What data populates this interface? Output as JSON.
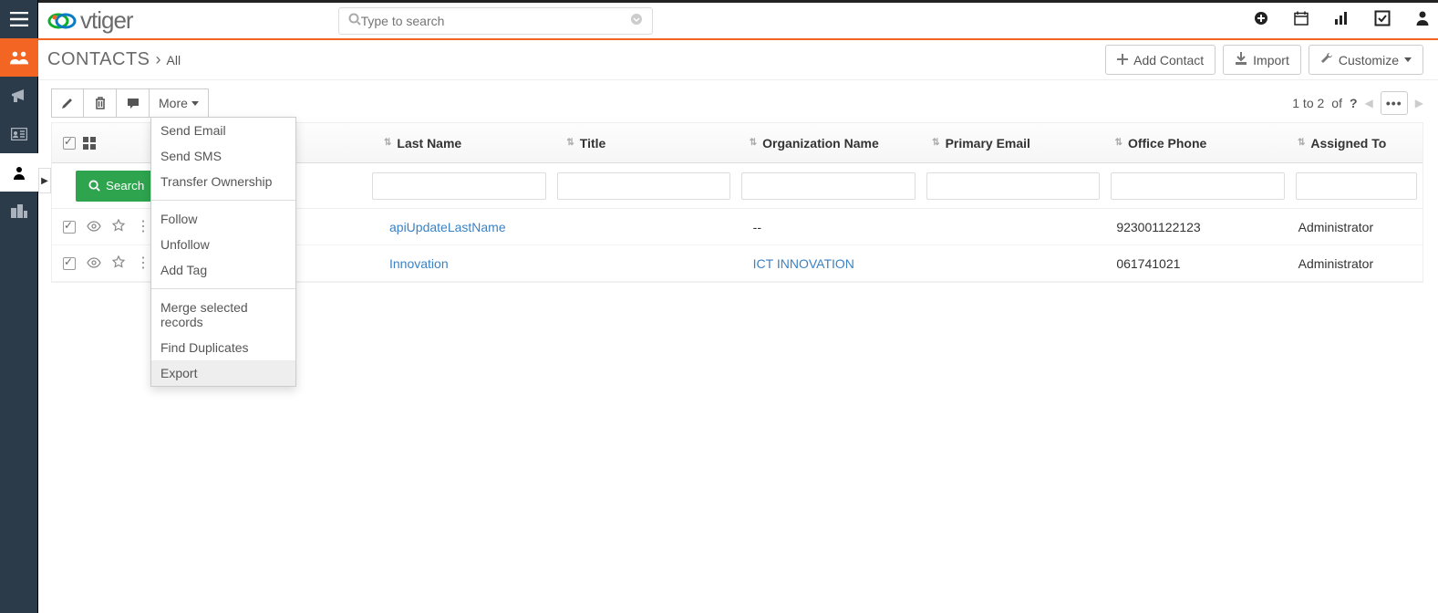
{
  "app": {
    "name": "vtiger"
  },
  "search": {
    "placeholder": "Type to search"
  },
  "breadcrumb": {
    "module": "CONTACTS",
    "filter": "All"
  },
  "header_buttons": {
    "add": "Add Contact",
    "import": "Import",
    "customize": "Customize"
  },
  "toolbar": {
    "more": "More"
  },
  "paging": {
    "range": "1 to 2",
    "of": "of",
    "total": "?"
  },
  "more_menu": {
    "send_email": "Send Email",
    "send_sms": "Send SMS",
    "transfer": "Transfer Ownership",
    "follow": "Follow",
    "unfollow": "Unfollow",
    "add_tag": "Add Tag",
    "merge": "Merge selected records",
    "find_dupes": "Find Duplicates",
    "export": "Export"
  },
  "columns": {
    "last_name": "Last Name",
    "title": "Title",
    "org": "Organization Name",
    "email": "Primary Email",
    "phone": "Office Phone",
    "assigned": "Assigned To"
  },
  "search_btn": "Search",
  "rows": [
    {
      "last_name": "apiUpdateLastName",
      "title": "",
      "org": "--",
      "org_link": false,
      "email": "",
      "phone": "923001122123",
      "assigned": "Administrator"
    },
    {
      "last_name": "Innovation",
      "title": "",
      "org": "ICT INNOVATION",
      "org_link": true,
      "email": "",
      "phone": "061741021",
      "assigned": "Administrator"
    }
  ]
}
